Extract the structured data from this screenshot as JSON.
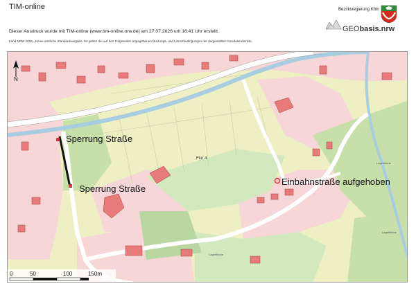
{
  "header": {
    "app_title": "TIM-online",
    "agency": "Bezirksregierung Köln",
    "logo_geo": "GEO",
    "logo_basis": "basis.nrw",
    "statement": "Dieser Ausdruck wurde mit TIM-online (www.tim-online.nrw.de) am 27.07.2026 um 16:41 Uhr erstellt.",
    "license": "Land NRW 2026 - Keine amtliche Standardausgabe. Es gelten die auf den Folgeseiten angegebenen Nutzungs- und Lizenzbedingungen der dargestellten Geodatendienste."
  },
  "map": {
    "annotations": {
      "closure_upper": "Sperrung Straße",
      "closure_lower": "Sperrung Straße",
      "one_way_lifted": "Einbahnstraße aufgehoben"
    },
    "flur_label": "Flur 4",
    "place_label_1": "Lagerfläche",
    "place_label_2": "Lagerfläche",
    "place_label_3": "Lagerfläche",
    "north_arrow": "N",
    "scale": {
      "tick_0": "0",
      "tick_50": "50",
      "tick_100": "100",
      "tick_150": "150m"
    }
  },
  "colors": {
    "settlement": "#f6d6d6",
    "building": "#e87a7a",
    "meadow": "#eef0c4",
    "forest": "#c7dfa8",
    "green": "#d4e8c0",
    "road": "#ffffff",
    "water": "#a9cde0",
    "annotation_marker": "#e03030"
  }
}
